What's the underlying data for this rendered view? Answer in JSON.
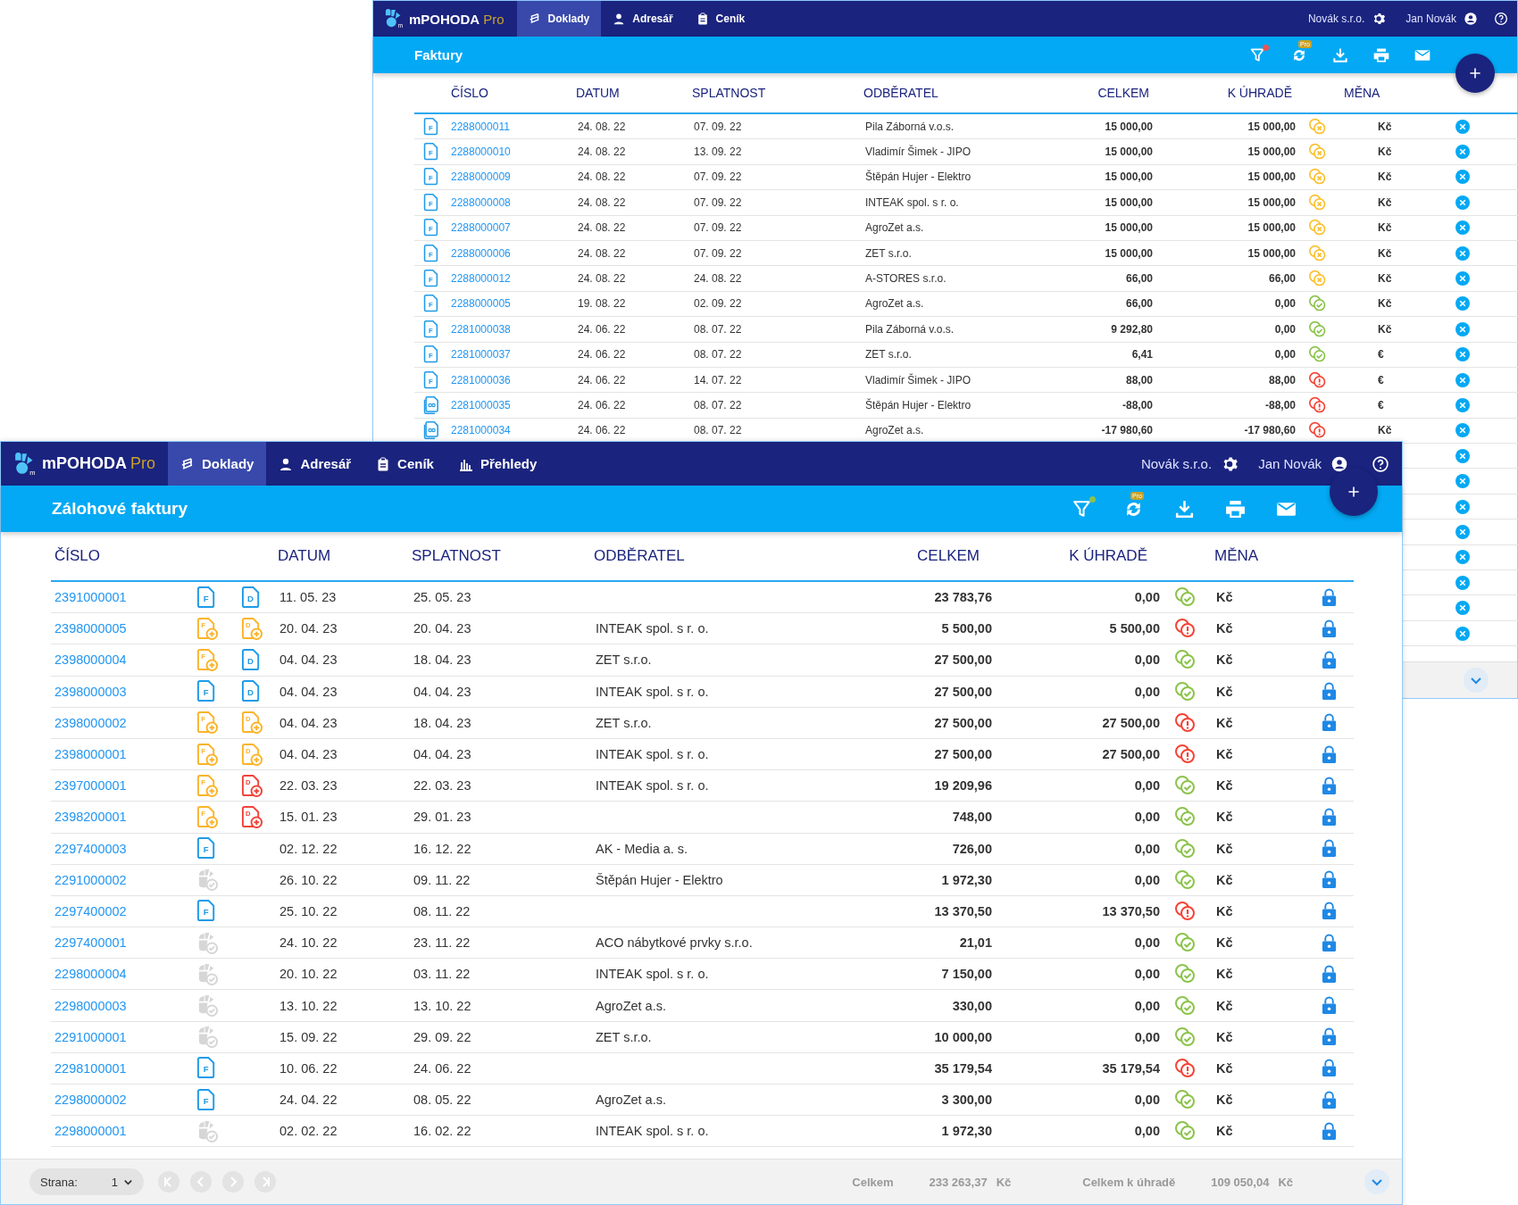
{
  "windows": [
    {
      "kind": "back",
      "navbar": {
        "logo_mark": "m",
        "logo": "mPOHODA",
        "edition": "Pro",
        "tabs": [
          {
            "label": "Doklady",
            "selected": true
          },
          {
            "label": "Adresář",
            "selected": false
          },
          {
            "label": "Ceník",
            "selected": false
          }
        ],
        "company": "Novák s.r.o.",
        "user": "Jan Novák"
      },
      "title": "Faktury",
      "toolbar": {
        "filter_dot": {
          "color": "#ef5350"
        },
        "sync_badge": "Pro"
      },
      "columns": [
        "ČÍSLO",
        "DATUM",
        "SPLATNOST",
        "ODBĚRATEL",
        "CELKEM",
        "K ÚHRADĚ",
        "MĚNA"
      ],
      "rows": [
        {
          "docs": [
            {
              "kind": "issued",
              "letter": "F"
            }
          ],
          "number": "2288000011",
          "date": "24. 08. 22",
          "due": "07. 09. 22",
          "customer": "Pila Záborná v.o.s.",
          "total": "15 000,00",
          "to_pay": "15 000,00",
          "paid": false,
          "overdue": false,
          "currency": "Kč"
        },
        {
          "docs": [
            {
              "kind": "issued",
              "letter": "F"
            }
          ],
          "number": "2288000010",
          "date": "24. 08. 22",
          "due": "13. 09. 22",
          "customer": "Vladimír Šimek - JIPO",
          "total": "15 000,00",
          "to_pay": "15 000,00",
          "paid": false,
          "overdue": false,
          "currency": "Kč"
        },
        {
          "docs": [
            {
              "kind": "issued",
              "letter": "F"
            }
          ],
          "number": "2288000009",
          "date": "24. 08. 22",
          "due": "07. 09. 22",
          "customer": "Štěpán Hujer - Elektro",
          "total": "15 000,00",
          "to_pay": "15 000,00",
          "paid": false,
          "overdue": false,
          "currency": "Kč"
        },
        {
          "docs": [
            {
              "kind": "issued",
              "letter": "F"
            }
          ],
          "number": "2288000008",
          "date": "24. 08. 22",
          "due": "07. 09. 22",
          "customer": "INTEAK spol. s r. o.",
          "total": "15 000,00",
          "to_pay": "15 000,00",
          "paid": false,
          "overdue": false,
          "currency": "Kč"
        },
        {
          "docs": [
            {
              "kind": "issued",
              "letter": "F"
            }
          ],
          "number": "2288000007",
          "date": "24. 08. 22",
          "due": "07. 09. 22",
          "customer": "AgroZet a.s.",
          "total": "15 000,00",
          "to_pay": "15 000,00",
          "paid": false,
          "overdue": false,
          "currency": "Kč"
        },
        {
          "docs": [
            {
              "kind": "issued",
              "letter": "F"
            }
          ],
          "number": "2288000006",
          "date": "24. 08. 22",
          "due": "07. 09. 22",
          "customer": "ZET s.r.o.",
          "total": "15 000,00",
          "to_pay": "15 000,00",
          "paid": false,
          "overdue": false,
          "currency": "Kč"
        },
        {
          "docs": [
            {
              "kind": "issued",
              "letter": "F"
            }
          ],
          "number": "2288000012",
          "date": "24. 08. 22",
          "due": "24. 08. 22",
          "customer": "A-STORES s.r.o.",
          "total": "66,00",
          "to_pay": "66,00",
          "paid": false,
          "overdue": false,
          "currency": "Kč"
        },
        {
          "docs": [
            {
              "kind": "issued",
              "letter": "F"
            }
          ],
          "number": "2288000005",
          "date": "19. 08. 22",
          "due": "02. 09. 22",
          "customer": "AgroZet a.s.",
          "total": "66,00",
          "to_pay": "0,00",
          "paid": true,
          "overdue": false,
          "currency": "Kč"
        },
        {
          "docs": [
            {
              "kind": "issued",
              "letter": "F"
            }
          ],
          "number": "2281000038",
          "date": "24. 06. 22",
          "due": "08. 07. 22",
          "customer": "Pila Záborná v.o.s.",
          "total": "9 292,80",
          "to_pay": "0,00",
          "paid": true,
          "overdue": false,
          "currency": "Kč"
        },
        {
          "docs": [
            {
              "kind": "issued",
              "letter": "F"
            }
          ],
          "number": "2281000037",
          "date": "24. 06. 22",
          "due": "08. 07. 22",
          "customer": "ZET s.r.o.",
          "total": "6,41",
          "to_pay": "0,00",
          "paid": true,
          "overdue": false,
          "currency": "€"
        },
        {
          "docs": [
            {
              "kind": "issued",
              "letter": "F"
            }
          ],
          "number": "2281000036",
          "date": "24. 06. 22",
          "due": "14. 07. 22",
          "customer": "Vladimír Šimek - JIPO",
          "total": "88,00",
          "to_pay": "88,00",
          "paid": false,
          "overdue": true,
          "currency": "€"
        },
        {
          "docs": [
            {
              "kind": "credit"
            }
          ],
          "number": "2281000035",
          "date": "24. 06. 22",
          "due": "08. 07. 22",
          "customer": "Štěpán Hujer - Elektro",
          "total": "-88,00",
          "to_pay": "-88,00",
          "paid": false,
          "overdue": true,
          "currency": "€"
        },
        {
          "docs": [
            {
              "kind": "credit"
            }
          ],
          "number": "2281000034",
          "date": "24. 06. 22",
          "due": "08. 07. 22",
          "customer": "AgroZet a.s.",
          "total": "-17 980,60",
          "to_pay": "-17 980,60",
          "paid": false,
          "overdue": true,
          "currency": "Kč"
        }
      ],
      "covered_rows": [
        {
          "kind": "cancel"
        },
        {
          "kind": "cancel"
        },
        {
          "kind": "cancel"
        },
        {
          "kind": "cancel"
        },
        {
          "kind": "cancel"
        },
        {
          "kind": "cancel"
        },
        {
          "kind": "cancel"
        },
        {
          "kind": "cancel"
        }
      ]
    },
    {
      "kind": "front",
      "navbar": {
        "logo_mark": "m",
        "logo": "mPOHODA",
        "edition": "Pro",
        "tabs": [
          {
            "label": "Doklady",
            "selected": true
          },
          {
            "label": "Adresář",
            "selected": false
          },
          {
            "label": "Ceník",
            "selected": false
          },
          {
            "label": "Přehledy",
            "selected": false
          }
        ],
        "company": "Novák s.r.o.",
        "user": "Jan Novák"
      },
      "title": "Zálohové faktury",
      "toolbar": {
        "filter_dot": {
          "color": "#8bc34a"
        },
        "sync_badge": "Pro"
      },
      "columns": [
        "ČÍSLO",
        "DATUM",
        "SPLATNOST",
        "ODBĚRATEL",
        "CELKEM",
        "K ÚHRADĚ",
        "MĚNA"
      ],
      "rows": [
        {
          "number": "2391000001",
          "docs": [
            {
              "kind": "issued",
              "letter": "F"
            },
            {
              "kind": "issued",
              "letter": "D"
            }
          ],
          "date": "11. 05. 23",
          "due": "25. 05. 23",
          "total": "23 783,76",
          "to_pay": "0,00",
          "paid": true,
          "overdue": false,
          "currency": "Kč"
        },
        {
          "number": "2398000005",
          "docs": [
            {
              "kind": "pending",
              "letter": "F"
            },
            {
              "kind": "pending",
              "letter": "D"
            }
          ],
          "date": "20. 04. 23",
          "due": "20. 04. 23",
          "customer": "INTEAK spol. s r. o.",
          "total": "5 500,00",
          "to_pay": "5 500,00",
          "paid": false,
          "overdue": true,
          "currency": "Kč"
        },
        {
          "number": "2398000004",
          "docs": [
            {
              "kind": "pending",
              "letter": "F"
            },
            {
              "kind": "issued",
              "letter": "D"
            }
          ],
          "date": "04. 04. 23",
          "due": "18. 04. 23",
          "customer": "ZET s.r.o.",
          "total": "27 500,00",
          "to_pay": "0,00",
          "paid": true,
          "overdue": false,
          "currency": "Kč"
        },
        {
          "number": "2398000003",
          "docs": [
            {
              "kind": "issued",
              "letter": "F"
            },
            {
              "kind": "issued",
              "letter": "D"
            }
          ],
          "date": "04. 04. 23",
          "due": "04. 04. 23",
          "customer": "INTEAK spol. s r. o.",
          "total": "27 500,00",
          "to_pay": "0,00",
          "paid": true,
          "overdue": false,
          "currency": "Kč"
        },
        {
          "number": "2398000002",
          "docs": [
            {
              "kind": "pending",
              "letter": "F"
            },
            {
              "kind": "pending",
              "letter": "D"
            }
          ],
          "date": "04. 04. 23",
          "due": "18. 04. 23",
          "customer": "ZET s.r.o.",
          "total": "27 500,00",
          "to_pay": "27 500,00",
          "paid": false,
          "overdue": true,
          "currency": "Kč"
        },
        {
          "number": "2398000001",
          "docs": [
            {
              "kind": "pending",
              "letter": "F"
            },
            {
              "kind": "pending",
              "letter": "D"
            }
          ],
          "date": "04. 04. 23",
          "due": "04. 04. 23",
          "customer": "INTEAK spol. s r. o.",
          "total": "27 500,00",
          "to_pay": "27 500,00",
          "paid": false,
          "overdue": true,
          "currency": "Kč"
        },
        {
          "number": "2397000001",
          "docs": [
            {
              "kind": "pending",
              "letter": "F"
            },
            {
              "kind": "overdue",
              "letter": "D"
            }
          ],
          "date": "22. 03. 23",
          "due": "22. 03. 23",
          "customer": "INTEAK spol. s r. o.",
          "total": "19 209,96",
          "to_pay": "0,00",
          "paid": true,
          "overdue": false,
          "currency": "Kč"
        },
        {
          "number": "2398200001",
          "docs": [
            {
              "kind": "pending",
              "letter": "F"
            },
            {
              "kind": "overdue",
              "letter": "D"
            }
          ],
          "date": "15. 01. 23",
          "due": "29. 01. 23",
          "total": "748,00",
          "to_pay": "0,00",
          "paid": true,
          "overdue": false,
          "currency": "Kč"
        },
        {
          "number": "2297400003",
          "docs": [
            {
              "kind": "issued",
              "letter": "F"
            }
          ],
          "date": "02. 12. 22",
          "due": "16. 12. 22",
          "customer": "AK - Media a. s.",
          "total": "726,00",
          "to_pay": "0,00",
          "paid": true,
          "overdue": false,
          "currency": "Kč"
        },
        {
          "number": "2291000002",
          "docs": [
            {
              "kind": "settled"
            }
          ],
          "date": "26. 10. 22",
          "due": "09. 11. 22",
          "customer": "Štěpán Hujer - Elektro",
          "total": "1 972,30",
          "to_pay": "0,00",
          "paid": true,
          "overdue": false,
          "currency": "Kč"
        },
        {
          "number": "2297400002",
          "docs": [
            {
              "kind": "issued",
              "letter": "F"
            }
          ],
          "date": "25. 10. 22",
          "due": "08. 11. 22",
          "total": "13 370,50",
          "to_pay": "13 370,50",
          "paid": false,
          "overdue": true,
          "currency": "Kč"
        },
        {
          "number": "2297400001",
          "docs": [
            {
              "kind": "settled"
            }
          ],
          "date": "24. 10. 22",
          "due": "23. 11. 22",
          "customer": "ACO nábytkové prvky s.r.o.",
          "total": "21,01",
          "to_pay": "0,00",
          "paid": true,
          "overdue": false,
          "currency": "Kč"
        },
        {
          "number": "2298000004",
          "docs": [
            {
              "kind": "settled"
            }
          ],
          "date": "20. 10. 22",
          "due": "03. 11. 22",
          "customer": "INTEAK spol. s r. o.",
          "total": "7 150,00",
          "to_pay": "0,00",
          "paid": true,
          "overdue": false,
          "currency": "Kč"
        },
        {
          "number": "2298000003",
          "docs": [
            {
              "kind": "settled"
            }
          ],
          "date": "13. 10. 22",
          "due": "13. 10. 22",
          "customer": "AgroZet a.s.",
          "total": "330,00",
          "to_pay": "0,00",
          "paid": true,
          "overdue": false,
          "currency": "Kč"
        },
        {
          "number": "2291000001",
          "docs": [
            {
              "kind": "settled"
            }
          ],
          "date": "15. 09. 22",
          "due": "29. 09. 22",
          "customer": "ZET s.r.o.",
          "total": "10 000,00",
          "to_pay": "0,00",
          "paid": true,
          "overdue": false,
          "currency": "Kč"
        },
        {
          "number": "2298100001",
          "docs": [
            {
              "kind": "issued",
              "letter": "F"
            }
          ],
          "date": "10. 06. 22",
          "due": "24. 06. 22",
          "total": "35 179,54",
          "to_pay": "35 179,54",
          "paid": false,
          "overdue": true,
          "currency": "Kč"
        },
        {
          "number": "2298000002",
          "docs": [
            {
              "kind": "issued",
              "letter": "F"
            }
          ],
          "date": "24. 04. 22",
          "due": "08. 05. 22",
          "customer": "AgroZet a.s.",
          "total": "3 300,00",
          "to_pay": "0,00",
          "paid": true,
          "overdue": false,
          "currency": "Kč"
        },
        {
          "number": "2298000001",
          "docs": [
            {
              "kind": "settled"
            }
          ],
          "date": "02. 02. 22",
          "due": "16. 02. 22",
          "customer": "INTEAK spol. s r. o.",
          "total": "1 972,30",
          "to_pay": "0,00",
          "paid": true,
          "overdue": false,
          "currency": "Kč"
        }
      ],
      "footer": {
        "page_label": "Strana:",
        "page": "1",
        "total_label": "Celkem",
        "total": "233 263,37",
        "total_currency": "Kč",
        "to_pay_label": "Celkem k úhradě",
        "to_pay": "109 050,04",
        "to_pay_currency": "Kč"
      }
    }
  ]
}
